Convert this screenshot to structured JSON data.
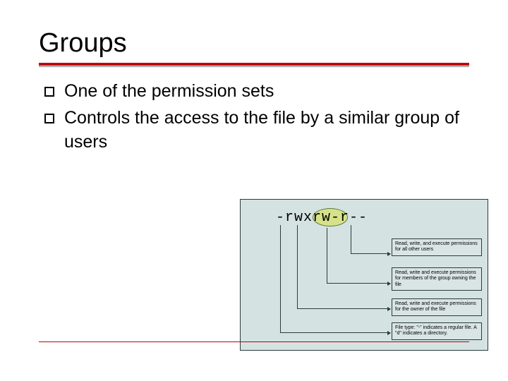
{
  "title": "Groups",
  "bullets": [
    "One of the permission sets",
    "Controls the access to the file by a similar group of users"
  ],
  "diagram": {
    "perm_string": "-rwxrw-r--",
    "highlight_segment": "rw-",
    "labels": [
      "Read, write, and execute permissions for all other users",
      "Read, write and execute permissions for members of the group owning the file",
      "Read, write and execute permissions for the owner of the file",
      "File type: \"-\" indicates a regular file. A \"d\" indicates a directory."
    ]
  }
}
